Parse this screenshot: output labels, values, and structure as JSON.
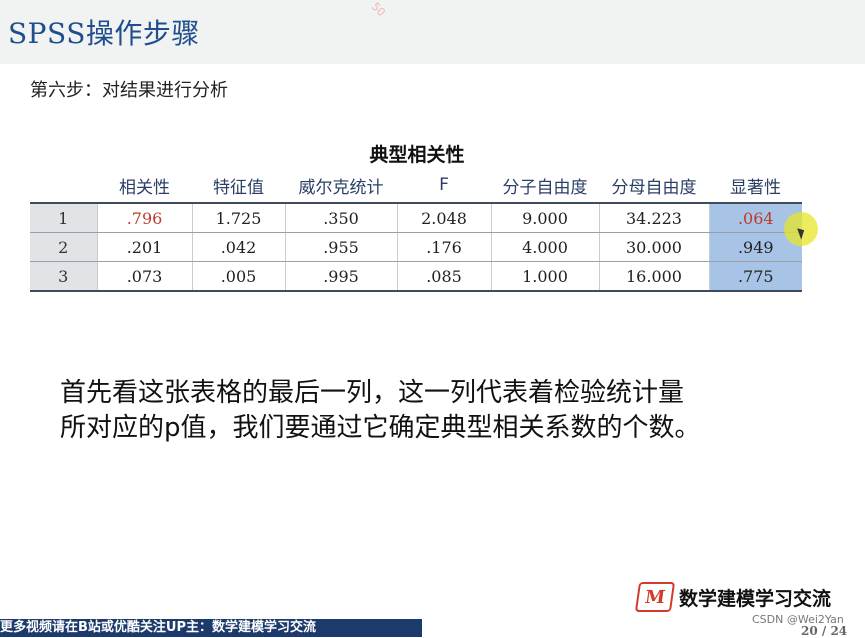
{
  "slide": {
    "title": "SPSS操作步骤",
    "watermark_top": "50",
    "step": "第六步：对结果进行分析",
    "table_title": "典型相关性",
    "columns": [
      "",
      "相关性",
      "特征值",
      "威尔克统计",
      "F",
      "分子自由度",
      "分母自由度",
      "显著性"
    ],
    "rows": [
      [
        "1",
        ".796",
        "1.725",
        ".350",
        "2.048",
        "9.000",
        "34.223",
        ".064"
      ],
      [
        "2",
        ".201",
        ".042",
        ".955",
        ".176",
        "4.000",
        "30.000",
        ".949"
      ],
      [
        "3",
        ".073",
        ".005",
        ".995",
        ".085",
        "1.000",
        "16.000",
        ".775"
      ]
    ],
    "description_line1": "首先看这张表格的最后一列，这一列代表着检验统计量",
    "description_line2": "所对应的p值，我们要通过它确定典型相关系数的个数。",
    "logo_letter": "M",
    "logo_text": "数学建模学习交流",
    "bottom_banner": "更多视频请在B站或优酷关注UP主：数学建模学习交流",
    "csdn_watermark": "CSDN @Wei2Yan",
    "page_number": "20 / 24",
    "colors": {
      "title": "#1e4f8c",
      "highlight_column": "#a7c3e6",
      "significant": "#c0392b",
      "banner": "#1c3a6b"
    }
  }
}
